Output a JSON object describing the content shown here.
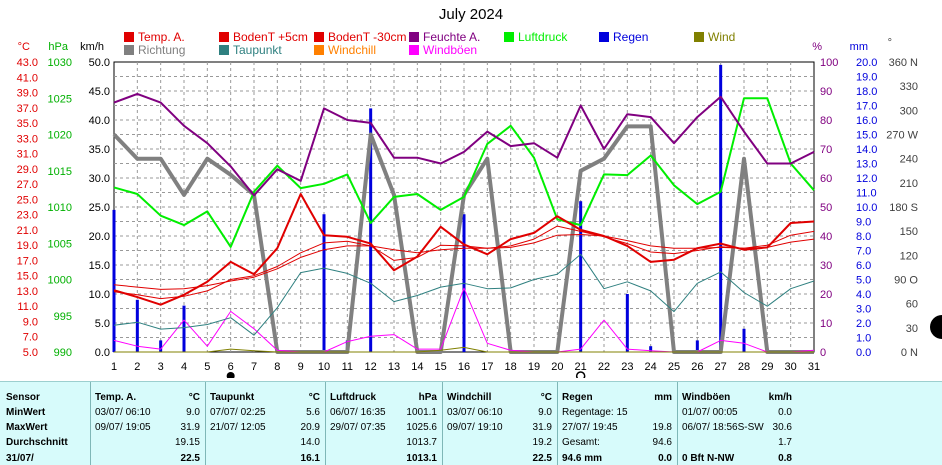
{
  "title": "July 2024",
  "legend": [
    {
      "label": "Temp. A.",
      "color": "#e00000"
    },
    {
      "label": "BodenT +5cm",
      "color": "#e00000"
    },
    {
      "label": "BodenT -30cm",
      "color": "#e00000"
    },
    {
      "label": "Feuchte A.",
      "color": "#800080"
    },
    {
      "label": "Luftdruck",
      "color": "#00ee00"
    },
    {
      "label": "Regen",
      "color": "#0000dd"
    },
    {
      "label": "Wind",
      "color": "#808000"
    },
    {
      "label": "Richtung",
      "color": "#808080"
    },
    {
      "label": "Taupunkt",
      "color": "#2f8080"
    },
    {
      "label": "Windchill",
      "color": "#ff8000"
    },
    {
      "label": "Windböen",
      "color": "#ff00ff"
    }
  ],
  "axis_units": {
    "temp": "°C",
    "pressure": "hPa",
    "wind": "km/h",
    "humidity": "%",
    "rain": "mm",
    "direction": "°"
  },
  "axes": {
    "temp": {
      "ticks": [
        "43.0",
        "41.0",
        "39.0",
        "37.0",
        "35.0",
        "33.0",
        "31.0",
        "29.0",
        "27.0",
        "25.0",
        "23.0",
        "21.0",
        "19.0",
        "17.0",
        "15.0",
        "13.0",
        "11.0",
        "9.0",
        "7.0",
        "5.0"
      ],
      "color": "#e00000"
    },
    "pressure": {
      "ticks": [
        "1030",
        "1025",
        "1020",
        "1015",
        "1010",
        "1005",
        "1000",
        "995",
        "990"
      ],
      "color": "#00b000"
    },
    "wind": {
      "ticks": [
        "50.0",
        "45.0",
        "40.0",
        "35.0",
        "30.0",
        "25.0",
        "20.0",
        "15.0",
        "10.0",
        "5.0",
        "0.0"
      ],
      "color": "#000000"
    },
    "humidity": {
      "ticks": [
        "100",
        "90",
        "80",
        "70",
        "60",
        "50",
        "40",
        "30",
        "20",
        "10",
        "0"
      ],
      "color": "#800080"
    },
    "rain": {
      "ticks": [
        "20.0",
        "19.0",
        "18.0",
        "17.0",
        "16.0",
        "15.0",
        "14.0",
        "13.0",
        "12.0",
        "11.0",
        "10.0",
        "9.0",
        "8.0",
        "7.0",
        "6.0",
        "5.0",
        "4.0",
        "3.0",
        "2.0",
        "1.0",
        "0.0"
      ],
      "color": "#0000dd"
    },
    "direction": {
      "ticks": [
        "360 N",
        "330",
        "300",
        "270 W",
        "240",
        "210",
        "180 S",
        "150",
        "120",
        "90 O",
        "60",
        "30",
        "0 N"
      ],
      "color": "#404040"
    }
  },
  "chart_data": {
    "type": "line",
    "x": [
      1,
      2,
      3,
      4,
      5,
      6,
      7,
      8,
      9,
      10,
      11,
      12,
      13,
      14,
      15,
      16,
      17,
      18,
      19,
      20,
      21,
      22,
      23,
      24,
      25,
      26,
      27,
      28,
      29,
      30,
      31
    ],
    "x_range": [
      1,
      31
    ],
    "series": [
      {
        "name": "Temp. A.",
        "axis": "temp",
        "values": [
          13.1,
          12.2,
          11.2,
          12.5,
          14.2,
          16.8,
          15.2,
          18.6,
          25.7,
          20.3,
          20.1,
          19.2,
          15.7,
          17.5,
          21.4,
          19.1,
          17.8,
          19.8,
          20.6,
          22.8,
          21.0,
          20.2,
          18.9,
          16.8,
          17.1,
          18.6,
          19.2,
          18.4,
          18.7,
          21.9,
          22.1
        ]
      },
      {
        "name": "BodenT +5cm",
        "axis": "temp",
        "values": [
          12.9,
          12.5,
          12.0,
          12.3,
          13.0,
          14.5,
          15.0,
          16.2,
          18.0,
          19.3,
          19.5,
          18.9,
          17.0,
          17.4,
          19.0,
          18.9,
          18.6,
          18.9,
          19.8,
          21.5,
          20.8,
          20.1,
          19.2,
          18.1,
          17.9,
          18.3,
          18.8,
          18.6,
          19.0,
          20.3,
          20.8
        ]
      },
      {
        "name": "BodenT -30cm",
        "axis": "temp",
        "values": [
          13.8,
          13.5,
          13.2,
          13.3,
          13.7,
          14.3,
          14.8,
          15.9,
          17.4,
          18.4,
          18.9,
          18.9,
          18.4,
          18.0,
          18.4,
          18.6,
          18.6,
          18.7,
          19.3,
          20.3,
          20.4,
          20.2,
          19.6,
          18.9,
          18.6,
          18.6,
          18.7,
          18.6,
          18.7,
          19.4,
          19.8
        ]
      },
      {
        "name": "Taupunkt",
        "axis": "temp",
        "values": [
          8.5,
          8.9,
          8.0,
          8.2,
          8.6,
          9.5,
          7.2,
          10.8,
          15.4,
          16.0,
          15.3,
          14.0,
          11.6,
          12.4,
          13.5,
          14.0,
          13.3,
          13.4,
          14.5,
          15.2,
          17.8,
          13.3,
          14.2,
          13.0,
          10.3,
          14.0,
          15.5,
          12.8,
          11.0,
          13.3,
          14.3
        ]
      },
      {
        "name": "Windchill",
        "axis": "temp",
        "values": [
          13.1,
          12.2,
          11.2,
          12.5,
          14.2,
          16.8,
          15.2,
          18.6,
          25.7,
          20.3,
          20.1,
          19.2,
          15.7,
          17.5,
          21.4,
          19.1,
          17.8,
          19.8,
          20.6,
          22.8,
          21.0,
          20.2,
          18.9,
          16.8,
          17.1,
          18.6,
          19.2,
          18.4,
          18.7,
          21.9,
          22.1
        ]
      },
      {
        "name": "Feuchte A.",
        "axis": "humidity",
        "values": [
          86,
          89,
          86,
          78,
          72,
          64,
          54,
          63,
          59,
          84,
          80,
          79,
          67,
          67,
          65,
          69,
          76,
          71,
          72,
          67,
          85,
          70,
          82,
          81,
          72,
          81,
          88,
          76,
          65,
          65,
          69
        ]
      },
      {
        "name": "Luftdruck",
        "axis": "pressure",
        "values": [
          1012.7,
          1011.8,
          1008.8,
          1007.5,
          1009.4,
          1004.5,
          1012.1,
          1015.7,
          1012.6,
          1013.2,
          1014.5,
          1007.8,
          1011.4,
          1011.8,
          1009.6,
          1011.4,
          1018.7,
          1021.2,
          1016.8,
          1008.3,
          1007.5,
          1014.5,
          1014.4,
          1017.1,
          1013.0,
          1010.4,
          1012.1,
          1025.0,
          1025.0,
          1016.0,
          1012.3
        ]
      },
      {
        "name": "Richtung",
        "axis": "direction",
        "values": [
          270,
          240,
          240,
          195,
          240,
          220,
          195,
          0,
          0,
          0,
          0,
          270,
          195,
          0,
          0,
          195,
          240,
          0,
          0,
          0,
          225,
          240,
          280,
          280,
          0,
          0,
          0,
          240,
          0,
          0,
          0
        ]
      },
      {
        "name": "Windböen",
        "axis": "wind",
        "values": [
          2,
          1,
          0.5,
          5.5,
          1,
          7,
          4,
          0.3,
          0,
          0,
          1.8,
          2.7,
          3,
          0.5,
          0.5,
          11,
          1.5,
          0.3,
          0,
          0,
          0.5,
          5.5,
          0.5,
          0.2,
          0,
          0,
          2,
          1.5,
          0,
          0,
          0.3
        ]
      },
      {
        "name": "Wind",
        "axis": "wind",
        "values": [
          0,
          0,
          0,
          0,
          0,
          0.5,
          0.2,
          0,
          0,
          0,
          0,
          0,
          0,
          0,
          0.3,
          0.8,
          0,
          0,
          0,
          0,
          0,
          0,
          0,
          0,
          0,
          0,
          0,
          0,
          0,
          0,
          0
        ]
      }
    ],
    "rain": {
      "name": "Regen",
      "axis": "rain",
      "values": [
        9.8,
        3.6,
        0.8,
        3.2,
        0,
        0,
        0,
        0,
        0,
        9.5,
        0.8,
        16.8,
        0,
        0,
        0,
        9.5,
        0,
        0.2,
        0,
        0,
        10.4,
        0,
        4.0,
        0.4,
        0,
        0.8,
        19.8,
        1.6,
        0,
        0,
        0
      ]
    }
  },
  "stats": {
    "row_labels": [
      "Sensor",
      "MinWert",
      "MaxWert",
      "Durchschnitt",
      "31/07/"
    ],
    "sections": [
      {
        "name": "Temp. A.",
        "unit": "°C",
        "rows": [
          [
            "03/07/ 06:10",
            "9.0"
          ],
          [
            "09/07/ 19:05",
            "31.9"
          ],
          [
            "",
            "19.15"
          ],
          [
            "",
            "22.5"
          ]
        ]
      },
      {
        "name": "Taupunkt",
        "unit": "°C",
        "rows": [
          [
            "07/07/ 02:25",
            "5.6"
          ],
          [
            "21/07/ 12:05",
            "20.9"
          ],
          [
            "",
            "14.0"
          ],
          [
            "",
            "16.1"
          ]
        ]
      },
      {
        "name": "Luftdruck",
        "unit": "hPa",
        "rows": [
          [
            "06/07/ 16:35",
            "1001.1"
          ],
          [
            "29/07/ 07:35",
            "1025.6"
          ],
          [
            "",
            "1013.7"
          ],
          [
            "",
            "1013.1"
          ]
        ]
      },
      {
        "name": "Windchill",
        "unit": "°C",
        "rows": [
          [
            "03/07/ 06:10",
            "9.0"
          ],
          [
            "09/07/ 19:10",
            "31.9"
          ],
          [
            "",
            "19.2"
          ],
          [
            "",
            "22.5"
          ]
        ]
      },
      {
        "name": "Regen",
        "unit": "mm",
        "rows": [
          [
            "Regentage: 15",
            ""
          ],
          [
            "27/07/ 19:45",
            "19.8"
          ],
          [
            "Gesamt:",
            "94.6"
          ],
          [
            "94.6 mm",
            "0.0"
          ]
        ]
      },
      {
        "name": "Windböen",
        "unit": "km/h",
        "rows": [
          [
            "01/07/ 00:05",
            "0.0"
          ],
          [
            "06/07/ 18:56S-SW",
            "30.6"
          ],
          [
            "",
            "1.7"
          ],
          [
            "0 Bft N-NW",
            "0.8"
          ]
        ]
      }
    ]
  }
}
